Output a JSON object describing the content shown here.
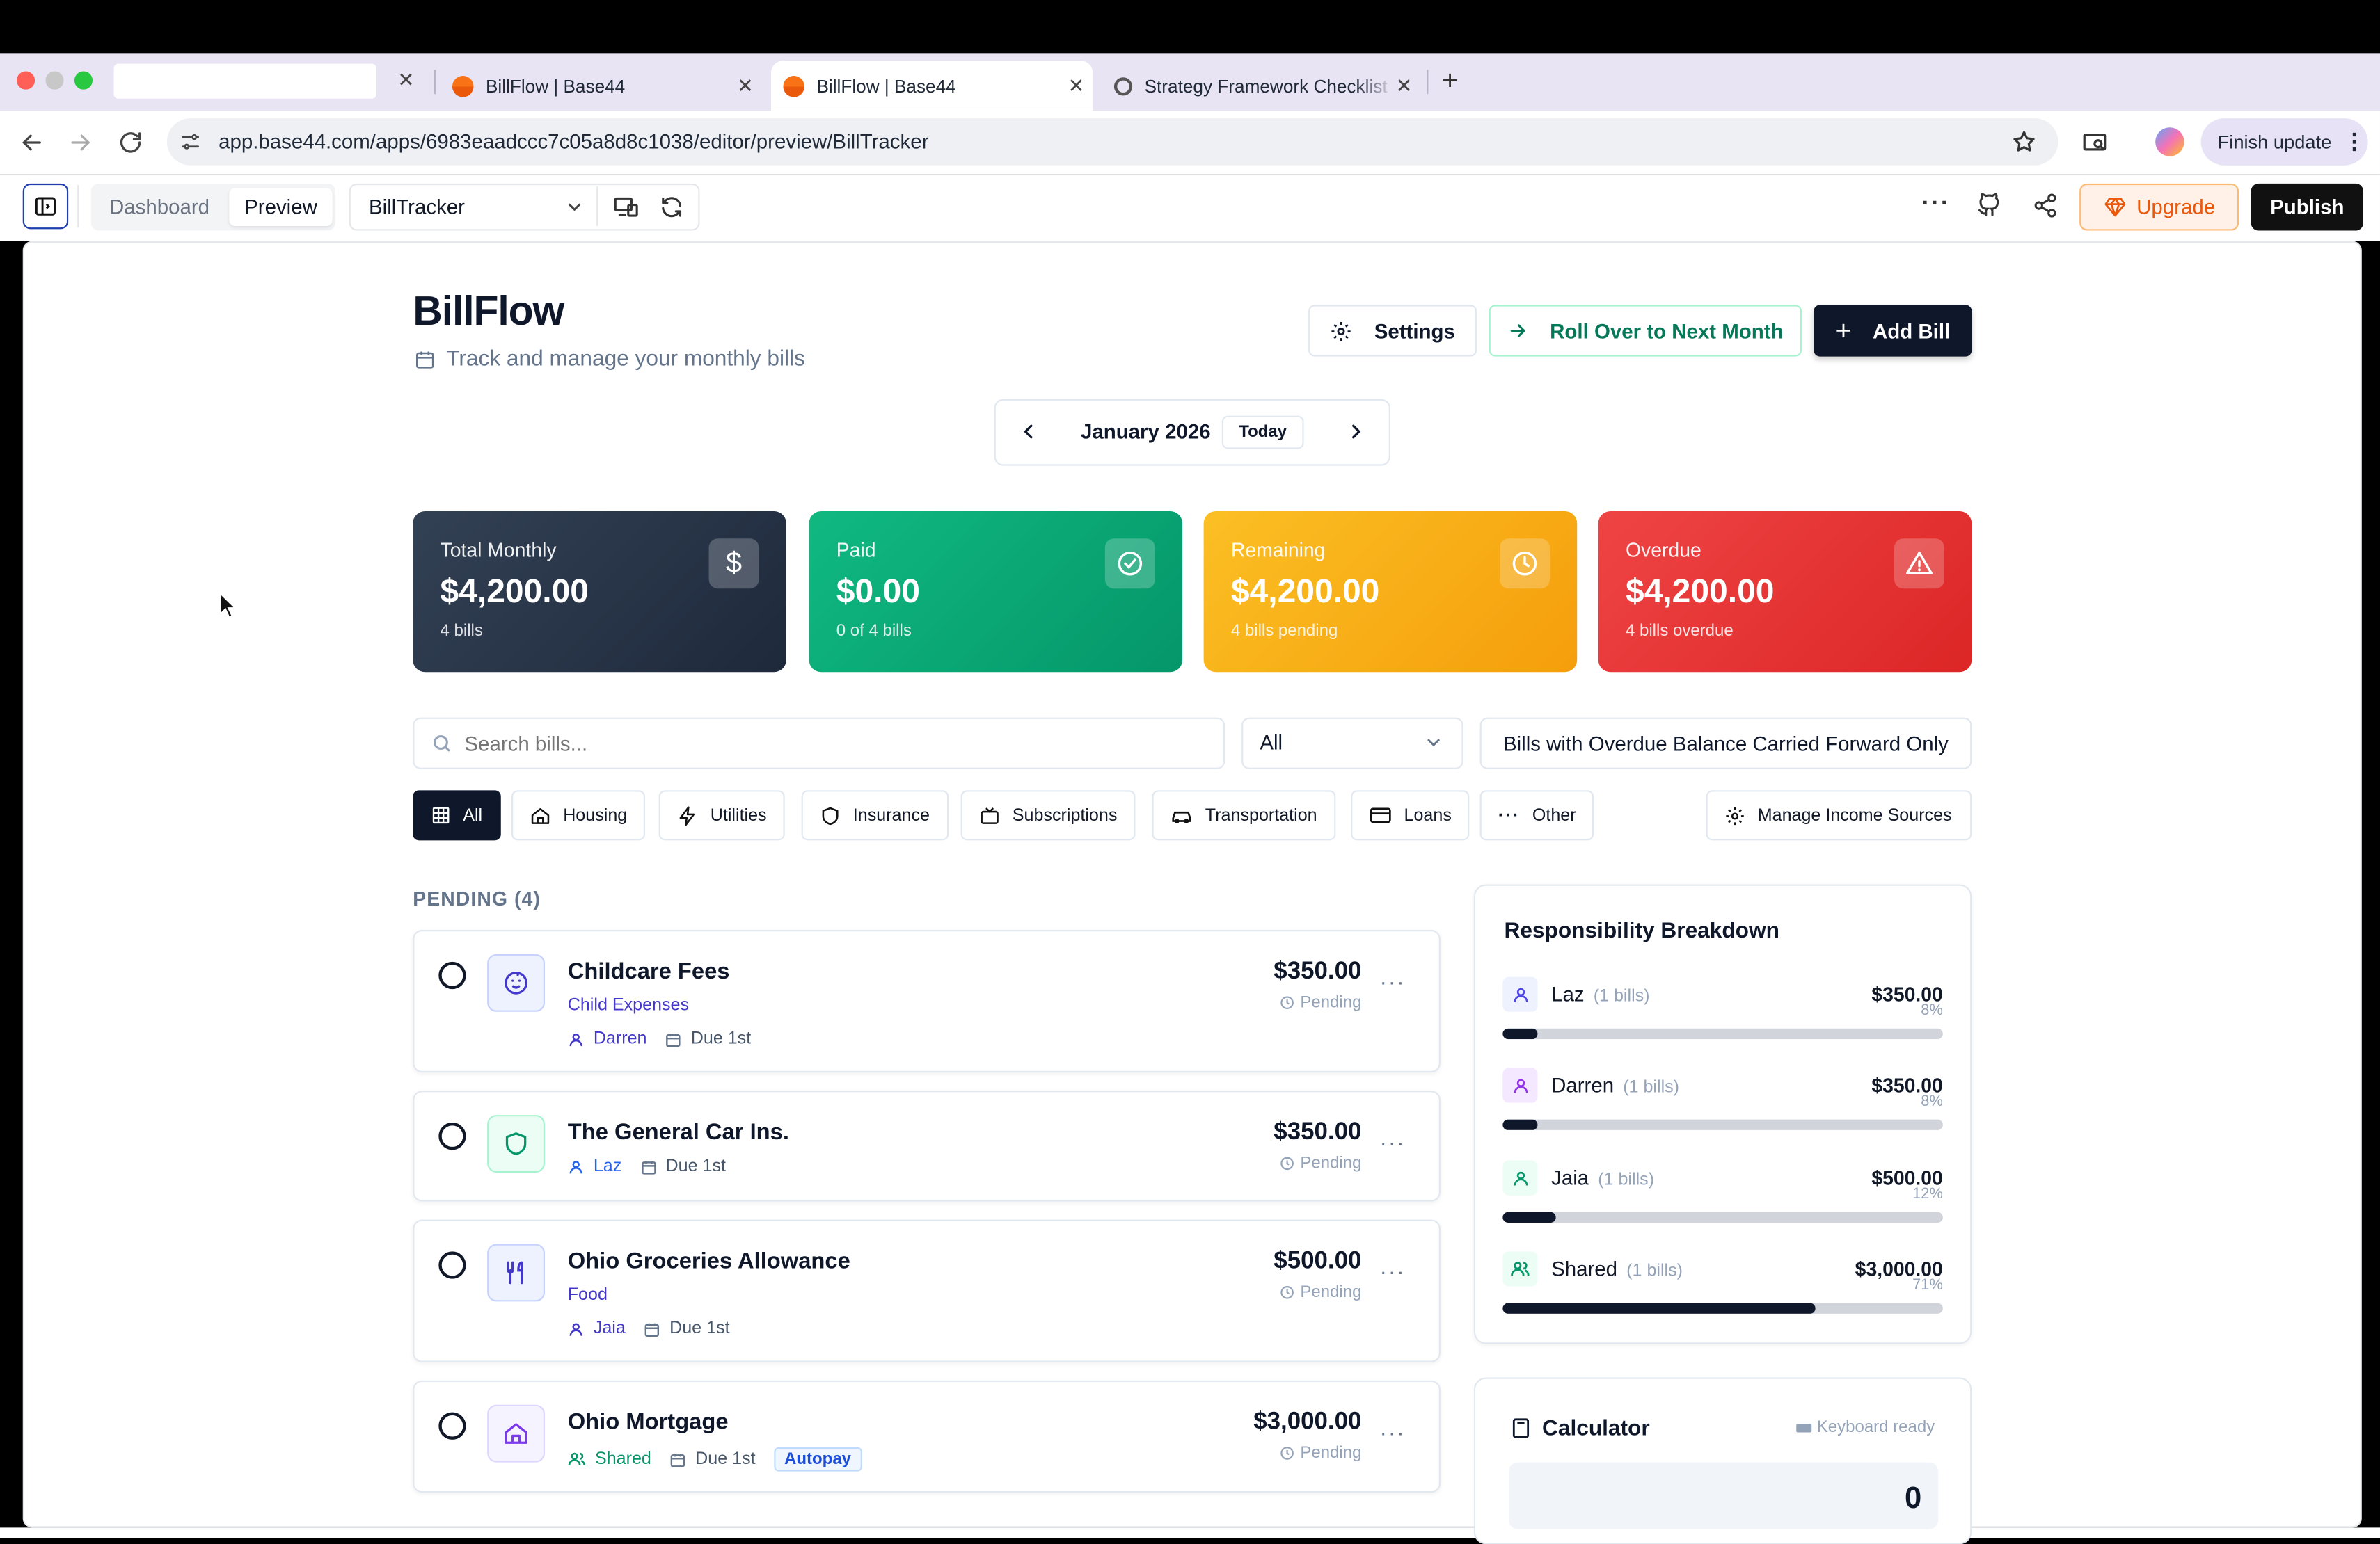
{
  "browser": {
    "tabs": [
      {
        "label": "",
        "active": false
      },
      {
        "label": "BillFlow | Base44",
        "active": false
      },
      {
        "label": "BillFlow | Base44",
        "active": true
      },
      {
        "label": "Strategy Framework Checklist",
        "active": false
      }
    ],
    "url": "app.base44.com/apps/6983eaadccc7c05a8d8c1038/editor/preview/BillTracker",
    "finish_update": "Finish update"
  },
  "editor": {
    "dashboard_tab": "Dashboard",
    "preview_tab": "Preview",
    "page_select": "BillTracker",
    "upgrade": "Upgrade",
    "publish": "Publish"
  },
  "header": {
    "title": "BillFlow",
    "subtitle": "Track and manage your monthly bills",
    "settings": "Settings",
    "rollover": "Roll Over to Next Month",
    "add_bill": "Add Bill"
  },
  "month_nav": {
    "month": "January 2026",
    "today": "Today"
  },
  "summary": [
    {
      "label": "Total Monthly",
      "value": "$4,200.00",
      "sub": "4 bills",
      "icon": "dollar-icon",
      "color": "#334155"
    },
    {
      "label": "Paid",
      "value": "$0.00",
      "sub": "0 of 4 bills",
      "icon": "check-circle-icon",
      "color": "#10b981"
    },
    {
      "label": "Remaining",
      "value": "$4,200.00",
      "sub": "4 bills pending",
      "icon": "clock-icon",
      "color": "#f59e0b"
    },
    {
      "label": "Overdue",
      "value": "$4,200.00",
      "sub": "4 bills overdue",
      "icon": "alert-triangle-icon",
      "color": "#ef4444"
    }
  ],
  "filters": {
    "search_placeholder": "Search bills...",
    "status_select": "All",
    "carried_forward": "Bills with Overdue Balance Carried Forward Only",
    "categories": [
      "All",
      "Housing",
      "Utilities",
      "Insurance",
      "Subscriptions",
      "Transportation",
      "Loans",
      "Other"
    ],
    "manage_income": "Manage Income Sources"
  },
  "pending_heading": "PENDING (4)",
  "bills": [
    {
      "name": "Childcare Fees",
      "category": "Child Expenses",
      "owner": "Darren",
      "due": "Due 1st",
      "amount": "$350.00",
      "status": "Pending",
      "icon": "baby-icon"
    },
    {
      "name": "The General Car Ins.",
      "category": "",
      "owner": "Laz",
      "due": "Due 1st",
      "amount": "$350.00",
      "status": "Pending",
      "icon": "shield-icon"
    },
    {
      "name": "Ohio Groceries Allowance",
      "category": "Food",
      "owner": "Jaia",
      "due": "Due 1st",
      "amount": "$500.00",
      "status": "Pending",
      "icon": "utensils-icon"
    },
    {
      "name": "Ohio Mortgage",
      "category": "",
      "owner": "Shared",
      "due": "Due 1st",
      "amount": "$3,000.00",
      "status": "Pending",
      "icon": "home-icon",
      "badge": "Autopay"
    }
  ],
  "responsibility": {
    "title": "Responsibility Breakdown",
    "people": [
      {
        "name": "Laz",
        "bills": "(1 bills)",
        "amount": "$350.00",
        "pct": "8%",
        "fraction": 0.08
      },
      {
        "name": "Darren",
        "bills": "(1 bills)",
        "amount": "$350.00",
        "pct": "8%",
        "fraction": 0.08
      },
      {
        "name": "Jaia",
        "bills": "(1 bills)",
        "amount": "$500.00",
        "pct": "12%",
        "fraction": 0.12
      },
      {
        "name": "Shared",
        "bills": "(1 bills)",
        "amount": "$3,000.00",
        "pct": "71%",
        "fraction": 0.71
      }
    ]
  },
  "calculator": {
    "title": "Calculator",
    "hint": "Keyboard ready",
    "display": "0"
  }
}
